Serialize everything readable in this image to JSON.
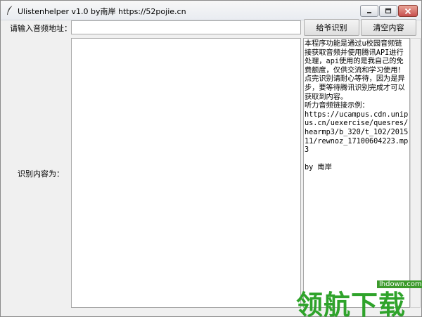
{
  "window": {
    "title": "Ulistenhelper v1.0 by南岸 https://52pojie.cn"
  },
  "form": {
    "url_label": "请输入音频地址：",
    "url_value": "",
    "result_label": "识别内容为：",
    "result_value": ""
  },
  "buttons": {
    "recognize": "给爷识别",
    "clear": "清空内容"
  },
  "info": {
    "text": "本程序功能是通过u校园音频链接获取音频并使用腾讯API进行处理，api使用的是我自己的免费额度，仅供交流和学习使用！\n点完识别请耐心等待，因为是异步，要等待腾讯识别完成才可以获取到内容。\n听力音频链接示例：\nhttps://ucampus.cdn.unipus.cn/uexercise/quesres/hearmp3/b_320/t_102/201511/rewnoz_17100604223.mp3\n\nby 南岸"
  },
  "watermark": {
    "site": "lhdown.com",
    "text": "领航下载"
  },
  "colors": {
    "watermark_green": "#2fa32b",
    "close_red": "#c75050"
  },
  "icons": {
    "app": "feather-icon",
    "minimize": "minimize-icon",
    "maximize": "maximize-icon",
    "close": "close-icon"
  }
}
